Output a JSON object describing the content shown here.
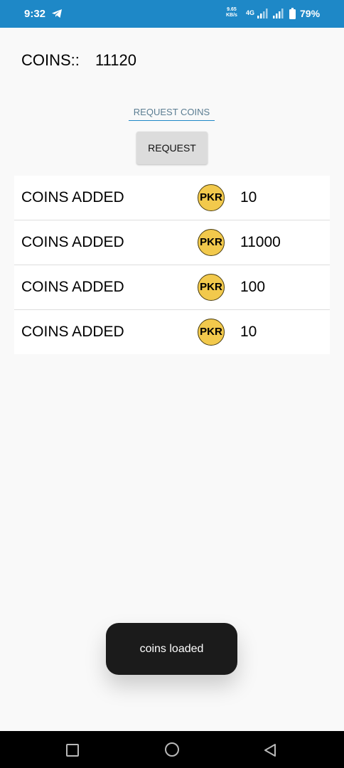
{
  "status_bar": {
    "time": "9:32",
    "net_speed_value": "9.65",
    "net_speed_unit": "KB/s",
    "network_type": "4G",
    "battery": "79%",
    "icons": [
      "telegram-icon",
      "signal-icon",
      "battery-icon"
    ]
  },
  "balance": {
    "label": "COINS::",
    "value": "11120"
  },
  "request_field": {
    "text": "REQUEST COINS"
  },
  "request_button": {
    "label": "REQUEST"
  },
  "history": [
    {
      "label": "COINS ADDED",
      "currency": "PKR",
      "amount": "10"
    },
    {
      "label": "COINS ADDED",
      "currency": "PKR",
      "amount": "11000"
    },
    {
      "label": "COINS ADDED",
      "currency": "PKR",
      "amount": "100"
    },
    {
      "label": "COINS ADDED",
      "currency": "PKR",
      "amount": "10"
    }
  ],
  "toast": {
    "message": "coins loaded"
  },
  "colors": {
    "status_bar": "#1e88c7",
    "coin": "#f2c94c",
    "toast": "#1b1b1b"
  }
}
